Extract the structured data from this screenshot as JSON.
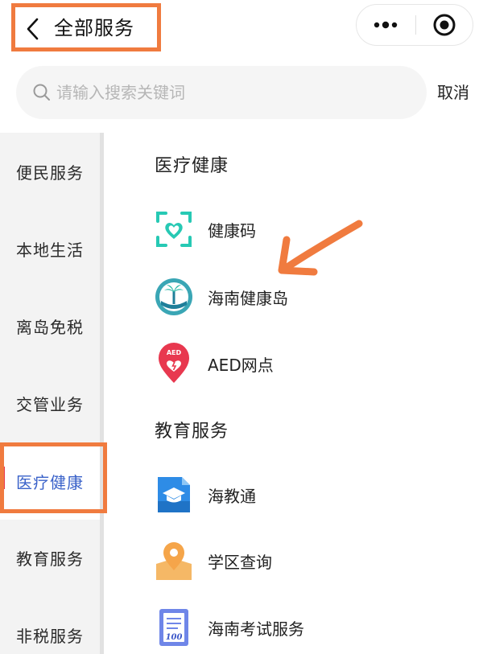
{
  "header": {
    "title": "全部服务",
    "back_icon": "chevron-left-icon",
    "more_icon": "more-dots-icon",
    "close_icon": "target-circle-icon"
  },
  "search": {
    "placeholder": "请输入搜索关键词",
    "value": "",
    "cancel_label": "取消"
  },
  "sidebar": {
    "items": [
      {
        "label": "便民服务",
        "active": false
      },
      {
        "label": "本地生活",
        "active": false
      },
      {
        "label": "离岛免税",
        "active": false
      },
      {
        "label": "交管业务",
        "active": false
      },
      {
        "label": "医疗健康",
        "active": true
      },
      {
        "label": "教育服务",
        "active": false
      },
      {
        "label": "非税服务",
        "active": false
      }
    ]
  },
  "sections": [
    {
      "title": "医疗健康",
      "services": [
        {
          "label": "健康码",
          "icon": "health-code-icon"
        },
        {
          "label": "海南健康岛",
          "icon": "hainan-health-island-icon"
        },
        {
          "label": "AED网点",
          "icon": "aed-location-icon"
        }
      ]
    },
    {
      "title": "教育服务",
      "services": [
        {
          "label": "海教通",
          "icon": "education-cap-icon"
        },
        {
          "label": "学区查询",
          "icon": "school-district-map-icon"
        },
        {
          "label": "海南考试服务",
          "icon": "exam-score-icon"
        }
      ]
    }
  ],
  "colors": {
    "annotation_orange": "#f07b3f",
    "active_blue": "#3a62c9",
    "active_marker_red": "#e8384f",
    "health_teal": "#27c9b4",
    "aed_red": "#e8384f",
    "edu_blue": "#2e8ce6",
    "map_orange": "#f5a54a"
  }
}
